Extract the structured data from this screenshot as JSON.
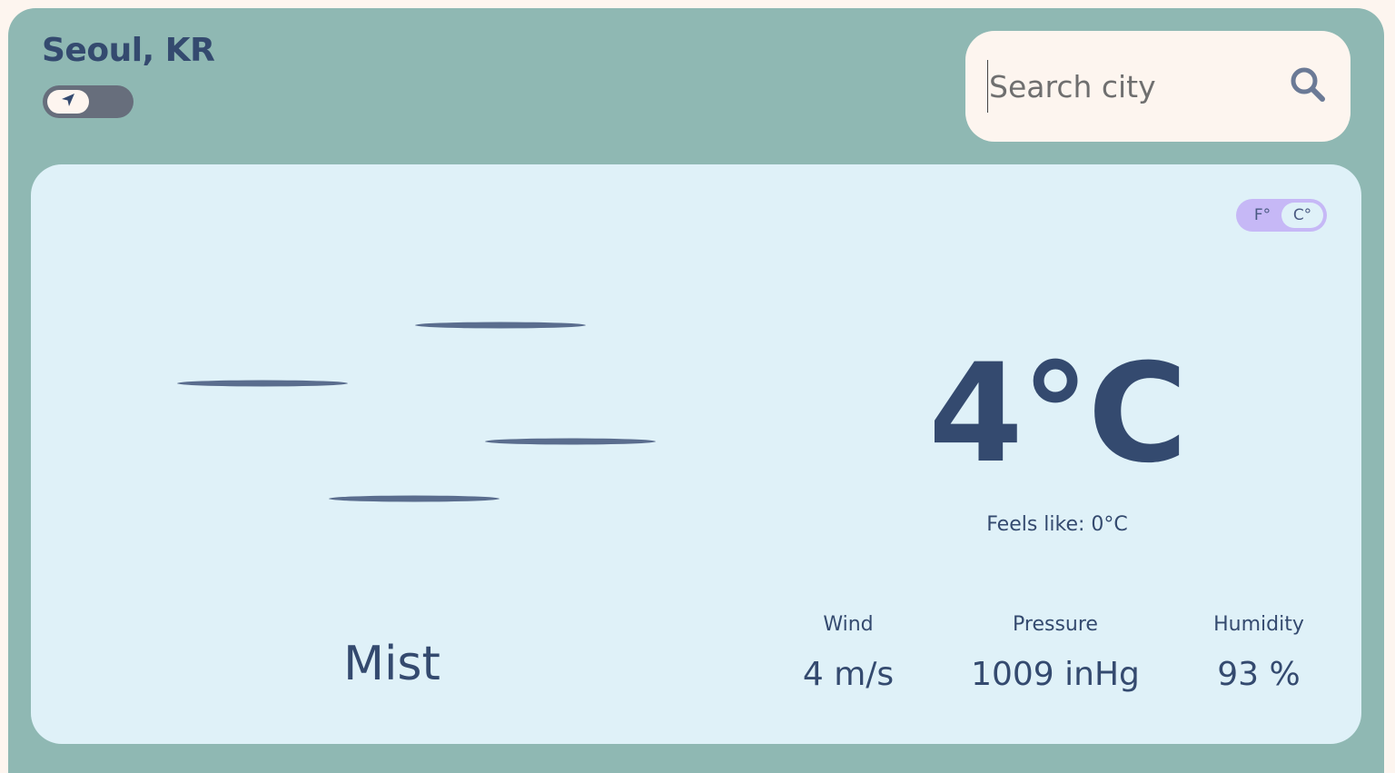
{
  "header": {
    "city": "Seoul, KR"
  },
  "search": {
    "placeholder": "Search city",
    "value": ""
  },
  "units": {
    "fahrenheit_label": "F°",
    "celsius_label": "C°",
    "selected": "C°"
  },
  "weather": {
    "condition": "Mist",
    "condition_icon": "mist-icon",
    "temperature": "4°C",
    "feels_like": "Feels like: 0°C"
  },
  "stats": [
    {
      "label": "Wind",
      "value": "4 m/s"
    },
    {
      "label": "Pressure",
      "value": "1009 inHg"
    },
    {
      "label": "Humidity",
      "value": "93 %"
    }
  ],
  "colors": {
    "app_bg": "#8fb8b3",
    "card_bg": "#dff1f8",
    "text": "#344a6f",
    "search_bg": "#fdf5ef",
    "unit_toggle": "#c6b8f6",
    "geo_toggle": "#676e7c"
  }
}
